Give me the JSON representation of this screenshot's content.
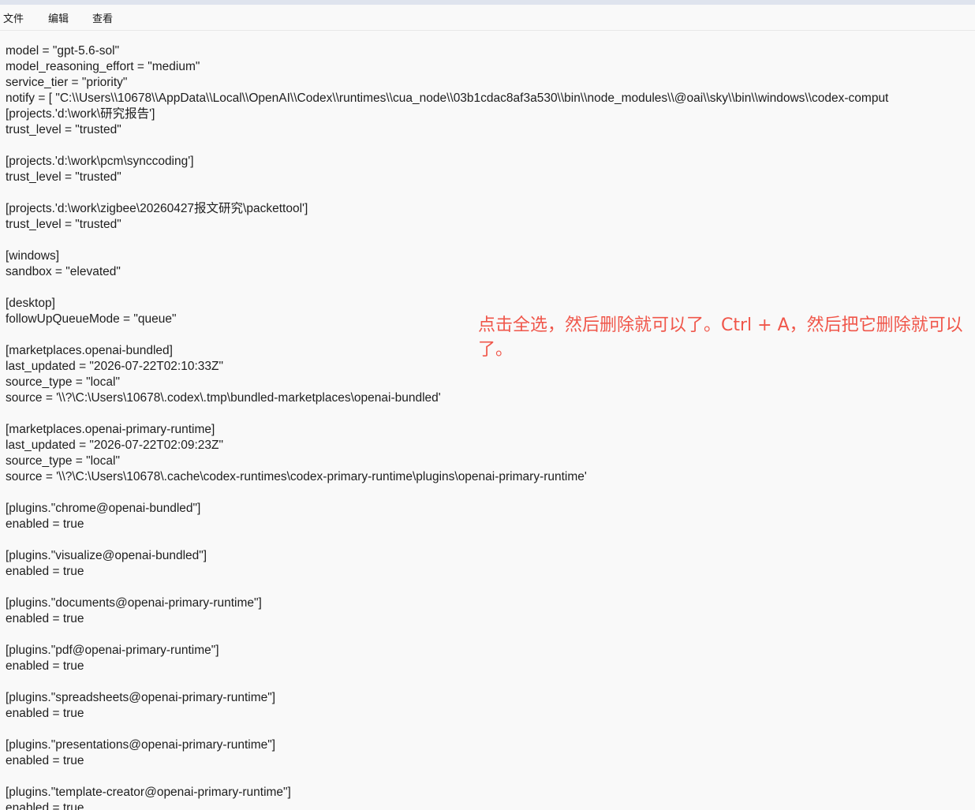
{
  "menu": {
    "file": "文件",
    "edit": "编辑",
    "view": "查看"
  },
  "editor_lines": [
    "model = \"gpt-5.6-sol\"",
    "model_reasoning_effort = \"medium\"",
    "service_tier = \"priority\"",
    "notify = [ \"C:\\\\Users\\\\10678\\\\AppData\\\\Local\\\\OpenAI\\\\Codex\\\\runtimes\\\\cua_node\\\\03b1cdac8af3a530\\\\bin\\\\node_modules\\\\@oai\\\\sky\\\\bin\\\\windows\\\\codex-comput",
    "[projects.'d:\\work\\研究报告']",
    "trust_level = \"trusted\"",
    "",
    "[projects.'d:\\work\\pcm\\synccoding']",
    "trust_level = \"trusted\"",
    "",
    "[projects.'d:\\work\\zigbee\\20260427报文研究\\packettool']",
    "trust_level = \"trusted\"",
    "",
    "[windows]",
    "sandbox = \"elevated\"",
    "",
    "[desktop]",
    "followUpQueueMode = \"queue\"",
    "",
    "[marketplaces.openai-bundled]",
    "last_updated = \"2026-07-22T02:10:33Z\"",
    "source_type = \"local\"",
    "source = '\\\\?\\C:\\Users\\10678\\.codex\\.tmp\\bundled-marketplaces\\openai-bundled'",
    "",
    "[marketplaces.openai-primary-runtime]",
    "last_updated = \"2026-07-22T02:09:23Z\"",
    "source_type = \"local\"",
    "source = '\\\\?\\C:\\Users\\10678\\.cache\\codex-runtimes\\codex-primary-runtime\\plugins\\openai-primary-runtime'",
    "",
    "[plugins.\"chrome@openai-bundled\"]",
    "enabled = true",
    "",
    "[plugins.\"visualize@openai-bundled\"]",
    "enabled = true",
    "",
    "[plugins.\"documents@openai-primary-runtime\"]",
    "enabled = true",
    "",
    "[plugins.\"pdf@openai-primary-runtime\"]",
    "enabled = true",
    "",
    "[plugins.\"spreadsheets@openai-primary-runtime\"]",
    "enabled = true",
    "",
    "[plugins.\"presentations@openai-primary-runtime\"]",
    "enabled = true",
    "",
    "[plugins.\"template-creator@openai-primary-runtime\"]",
    "enabled = true"
  ],
  "annotation": "点击全选，然后删除就可以了。Ctrl + A，然后把它删除就可以了。"
}
